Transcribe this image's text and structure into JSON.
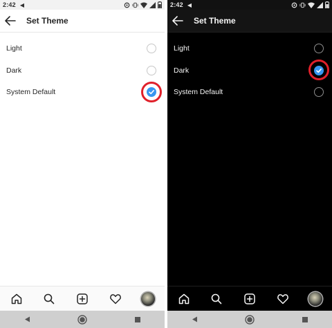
{
  "screens": [
    {
      "theme": "light",
      "status": {
        "time": "2:42"
      },
      "header": {
        "title": "Set Theme"
      },
      "options": [
        {
          "label": "Light",
          "checked": false
        },
        {
          "label": "Dark",
          "checked": false
        },
        {
          "label": "System Default",
          "checked": true
        }
      ]
    },
    {
      "theme": "dark",
      "status": {
        "time": "2:42"
      },
      "header": {
        "title": "Set Theme"
      },
      "options": [
        {
          "label": "Light",
          "checked": false
        },
        {
          "label": "Dark",
          "checked": true
        },
        {
          "label": "System Default",
          "checked": false
        }
      ]
    }
  ],
  "tabbar_icons": [
    "home-icon",
    "search-icon",
    "add-post-icon",
    "heart-icon",
    "profile-avatar"
  ],
  "sysnav_icons": [
    "back-triangle-icon",
    "home-circle-icon",
    "recents-square-icon"
  ],
  "colors": {
    "accent": "#3897f0",
    "highlight": "#e0202a",
    "light_bg": "#ffffff",
    "dark_bg": "#000000",
    "sysnav_bg": "#cfcfcf"
  }
}
